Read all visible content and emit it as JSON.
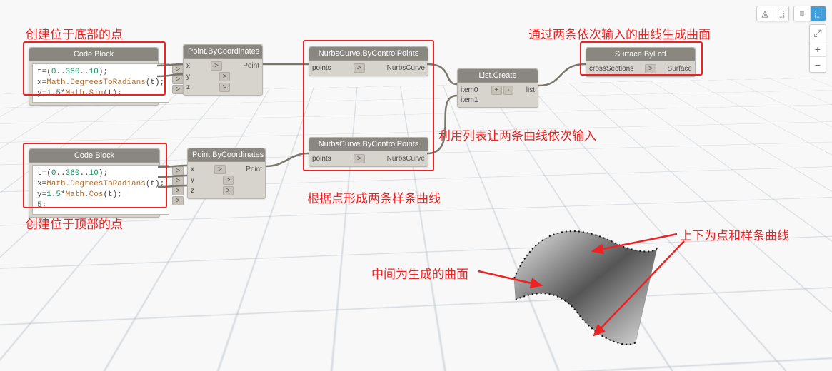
{
  "annotations": {
    "top_left": "创建位于底部的点",
    "top_right": "通过两条依次输入的曲线生成曲面",
    "bottom_left": "创建位于顶部的点",
    "nurbs_note": "根据点形成两条样条曲线",
    "list_note": "利用列表让两条曲线依次输入",
    "surface_note": "中间为生成的曲面",
    "curves_note": "上下为点和样条曲线"
  },
  "nodes": {
    "codeblock1": {
      "title": "Code Block",
      "code_html": "t=(<span class='num'>0</span>..<span class='num'>360</span>..<span class='num'>10</span>);\nx=<span class='fn'>Math.DegreesToRadians</span>(t);\ny=<span class='num'>1.5</span>*<span class='fn'>Math.Sin</span>(t);"
    },
    "codeblock2": {
      "title": "Code Block",
      "code_html": "t=(<span class='num'>0</span>..<span class='num'>360</span>..<span class='num'>10</span>);\nx=<span class='fn'>Math.DegreesToRadians</span>(t);\ny=<span class='num'>1.5</span>*<span class='fn'>Math.Cos</span>(t);\n<span class='num'>5</span>;"
    },
    "pointbycoords": {
      "title": "Point.ByCoordinates",
      "in": [
        "x",
        "y",
        "z"
      ],
      "out": "Point"
    },
    "nurbs": {
      "title": "NurbsCurve.ByControlPoints",
      "in": "points",
      "out": "NurbsCurve"
    },
    "listcreate": {
      "title": "List.Create",
      "rows": [
        "item0",
        "item1"
      ],
      "plus": "+",
      "minus": "-",
      "out": "list"
    },
    "surfaceloft": {
      "title": "Surface.ByLoft",
      "in": "crossSections",
      "out": "Surface"
    }
  },
  "toolbar": {
    "icon1": "◬",
    "icon2": "⬚",
    "icon3": "≡",
    "fit": "⤢",
    "plus": "+",
    "minus": "−"
  }
}
